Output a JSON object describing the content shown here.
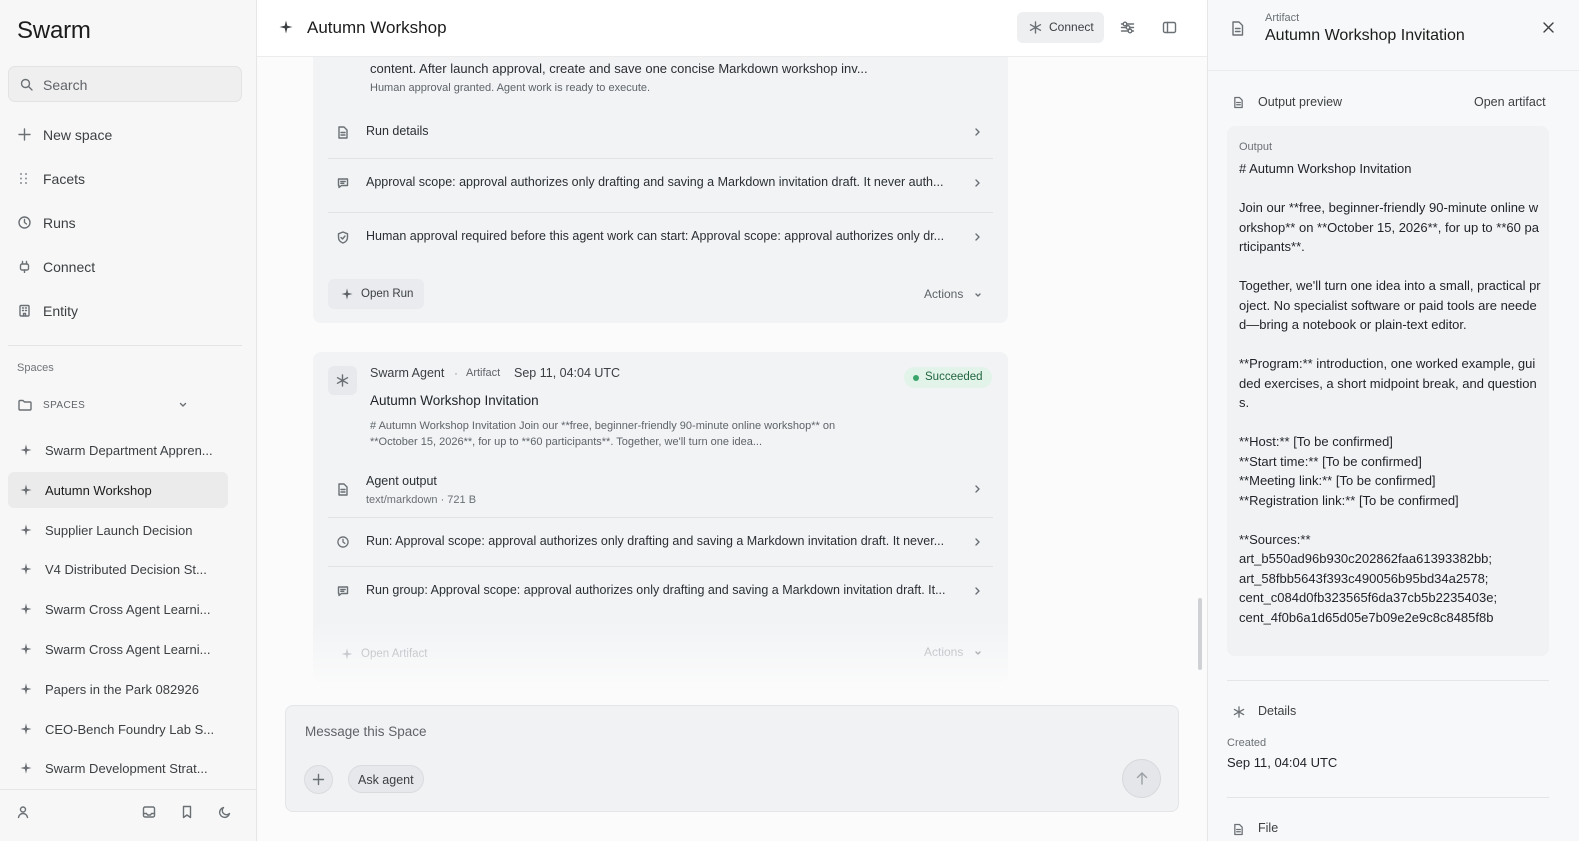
{
  "sidebar": {
    "app_name": "Swarm",
    "search_label": "Search",
    "nav": [
      {
        "label": "New space",
        "icon": "plus-icon"
      },
      {
        "label": "Facets",
        "icon": "grid-icon"
      },
      {
        "label": "Runs",
        "icon": "clock-icon"
      },
      {
        "label": "Connect",
        "icon": "plug-icon"
      },
      {
        "label": "Entity",
        "icon": "building-icon"
      }
    ],
    "spaces_heading": "Spaces",
    "spaces_group_label": "SPACES",
    "spaces": [
      "Swarm Department Appren...",
      "Autumn Workshop",
      "Supplier Launch Decision",
      "V4 Distributed Decision St...",
      "Swarm Cross Agent Learni...",
      "Swarm Cross Agent Learni...",
      "Papers in the Park 082926",
      "CEO-Bench Foundry Lab S...",
      "Swarm Development Strat..."
    ],
    "active_space_index": 1
  },
  "header": {
    "title": "Autumn Workshop",
    "connect_label": "Connect"
  },
  "card1": {
    "content_line": "content. After launch approval, create and save one concise Markdown workshop inv...",
    "approval_note": "Human approval granted. Agent work is ready to execute.",
    "rows": [
      {
        "label": "Run details",
        "icon": "document-icon"
      },
      {
        "label": "Approval scope: approval authorizes only drafting and saving a Markdown invitation draft. It never auth...",
        "icon": "message-icon"
      },
      {
        "label": "Human approval required before this agent work can start: Approval scope: approval authorizes only dr...",
        "icon": "shield-check-icon"
      }
    ],
    "open_label": "Open Run",
    "actions_label": "Actions"
  },
  "card2": {
    "agent_name": "Swarm Agent",
    "separator": "·",
    "kind": "Artifact",
    "timestamp": "Sep 11, 04:04 UTC",
    "status": "Succeeded",
    "title": "Autumn Workshop Invitation",
    "preview_line1": "# Autumn Workshop Invitation Join our **free, beginner-friendly 90-minute online workshop** on",
    "preview_line2": "**October 15, 2026**, for up to **60 participants**. Together, we'll turn one idea...",
    "output_row": {
      "label": "Agent output",
      "sub": "text/markdown · 721 B"
    },
    "rows": [
      {
        "label": "Run: Approval scope: approval authorizes only drafting and saving a Markdown invitation draft. It never...",
        "icon": "clock-icon"
      },
      {
        "label": "Run group: Approval scope: approval authorizes only drafting and saving a Markdown invitation draft. It...",
        "icon": "message-icon"
      }
    ],
    "open_label": "Open Artifact",
    "actions_label": "Actions"
  },
  "composer": {
    "placeholder": "Message this Space",
    "ask_agent_label": "Ask agent"
  },
  "artifact_panel": {
    "kicker": "Artifact",
    "title": "Autumn Workshop Invitation",
    "preview_label": "Output preview",
    "open_label": "Open artifact",
    "output_label": "Output",
    "output_text": "# Autumn Workshop Invitation\n\nJoin our **free, beginner-friendly 90-minute online workshop** on **October 15, 2026**, for up to **60 participants**.\n\nTogether, we'll turn one idea into a small, practical project. No specialist software or paid tools are needed—bring a notebook or plain-text editor.\n\n**Program:** introduction, one worked example, guided exercises, a short midpoint break, and questions.\n\n**Host:** [To be confirmed]\n**Start time:** [To be confirmed]\n**Meeting link:** [To be confirmed]\n**Registration link:** [To be confirmed]\n\n**Sources:**\nart_b550ad96b930c202862faa61393382bb;\nart_58fbb5643f393c490056b95bd34a2578;\ncent_c084d0fb323565f6da37cb5b2235403e;\ncent_4f0b6a1d65d05e7b09e2e9c8c8485f8b",
    "details_label": "Details",
    "created_label": "Created",
    "created_value": "Sep 11, 04:04 UTC",
    "file_label": "File"
  }
}
